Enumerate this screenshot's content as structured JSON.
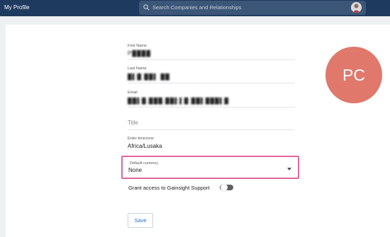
{
  "header": {
    "title": "My Profile",
    "search_placeholder": "Search Companies and Relationships"
  },
  "profile": {
    "initials": "PC",
    "first_name_label": "First Name",
    "first_name_value": "P████",
    "last_name_label": "Last Name",
    "last_name_value": "█▌█ ██▌ ██",
    "email_label": "Email",
    "email_value": "██▌█.███.██▌▌█ ██▌███▌█",
    "title_label": "Title",
    "timezone_label": "Enter timezone",
    "timezone_value": "Africa/Lusaka",
    "currency_label": "Default currency",
    "currency_value": "None",
    "gainsight_label": "Grant access to Gainsight Support",
    "gainsight_enabled": false,
    "save_label": "Save"
  },
  "colors": {
    "topbar": "#1e3a5f",
    "avatar_bg": "#e0786b",
    "highlight": "#e2669b",
    "link": "#1f6fc4"
  }
}
